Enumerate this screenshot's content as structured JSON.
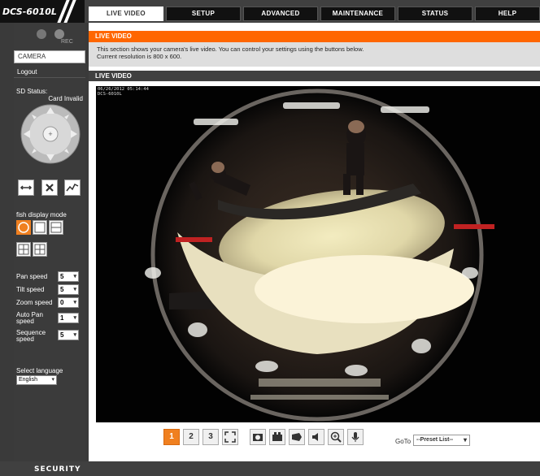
{
  "header": {
    "model": "DCS-6010L",
    "tabs": [
      {
        "label": "LIVE VIDEO",
        "active": true
      },
      {
        "label": "SETUP"
      },
      {
        "label": "ADVANCED"
      },
      {
        "label": "MAINTENANCE"
      },
      {
        "label": "STATUS"
      },
      {
        "label": "HELP"
      }
    ]
  },
  "sidebar": {
    "rec_icon": "rec-icon",
    "camera_label": "CAMERA",
    "logout_label": "Logout",
    "sd_status_label": "SD Status:",
    "sd_status_value": "Card Invalid",
    "ptz_buttons": [
      "horizontal-patrol-icon",
      "stop-icon",
      "preset-path-icon"
    ],
    "fish_label": "fish display mode",
    "speeds": [
      {
        "label": "Pan speed",
        "value": "5"
      },
      {
        "label": "Tilt speed",
        "value": "5"
      },
      {
        "label": "Zoom speed",
        "value": "0"
      },
      {
        "label": "Auto Pan speed",
        "value": "1"
      },
      {
        "label": "Sequence speed",
        "value": "5"
      }
    ],
    "language_label": "Select language",
    "language_value": "English"
  },
  "main": {
    "section_title": "LIVE VIDEO",
    "description_line1": "This section shows your camera's live video. You can control your settings using the buttons below.",
    "description_line2": "Current resolution is 800 x 600.",
    "live_bar": "LIVE VIDEO",
    "video_timestamp": "06/26/2012 05:14:44\nDCS-6010L",
    "controls": [
      "profile-1-icon",
      "profile-2-icon",
      "profile-3-icon",
      "fullscreen-icon",
      "snapshot-icon",
      "record-icon",
      "listen-icon",
      "speaker-icon",
      "zoom-icon",
      "microphone-icon"
    ],
    "controls_labels": [
      "1",
      "2",
      "3"
    ],
    "goto_label": "GoTo",
    "preset_value": "--Preset List--"
  },
  "footer": {
    "brand": "SECURITY"
  },
  "colors": {
    "accent": "#ff6600",
    "header_bg": "#404040",
    "sidebar_bg": "#3b3b3b",
    "selected_orange": "#f08020"
  }
}
